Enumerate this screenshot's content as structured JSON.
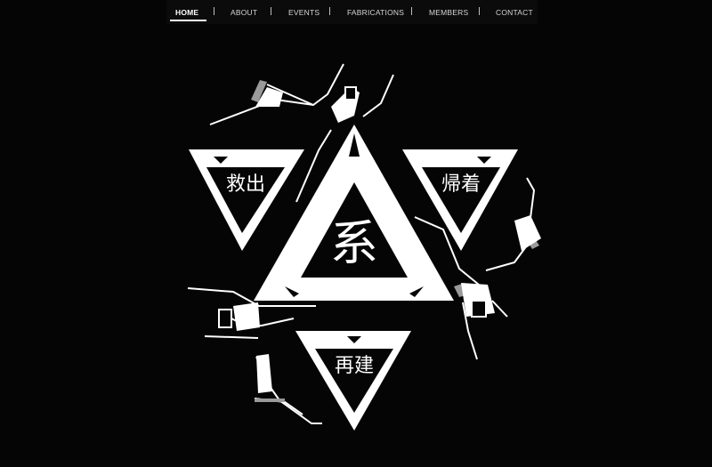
{
  "nav": {
    "items": [
      {
        "label": "HOME",
        "active": true
      },
      {
        "label": "ABOUT",
        "active": false
      },
      {
        "label": "EVENTS",
        "active": false
      },
      {
        "label": "FABRICATIONS",
        "active": false
      },
      {
        "label": "MEMBERS",
        "active": false
      },
      {
        "label": "CONTACT",
        "active": false
      }
    ]
  },
  "emblem": {
    "center_kanji": "系",
    "top_left_kanji": "救出",
    "top_right_kanji": "帰着",
    "bottom_kanji": "再建"
  },
  "colors": {
    "background": "#050505",
    "navbar": "#0b0b0b",
    "emblem": "#ffffff",
    "accent_gray": "#9a9a9a"
  }
}
